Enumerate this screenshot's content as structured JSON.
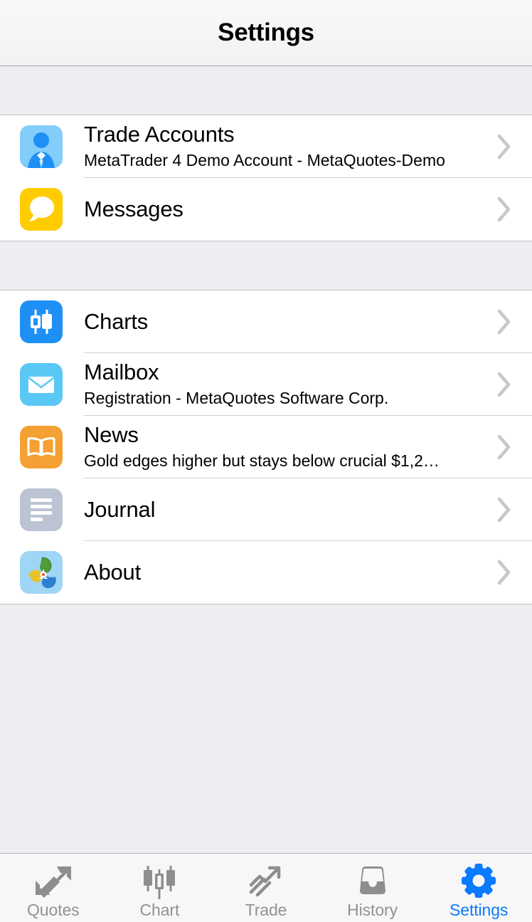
{
  "navbar": {
    "title": "Settings"
  },
  "colors": {
    "accent": "#0a7aff",
    "tab_inactive": "#929292",
    "section_bg": "#eeeef2",
    "row_bg": "#ffffff",
    "separator": "#d2d2d6",
    "chevron": "#c7c7cc",
    "icon_trade_accounts_bg": "#82cdfa",
    "icon_trade_accounts_fg": "#1e90f5",
    "icon_messages_bg": "#ffcc00",
    "icon_charts_bg": "#1e90f5",
    "icon_mailbox_bg": "#5ac8f5",
    "icon_news_bg": "#f5a032",
    "icon_journal_bg": "#bcc3d2",
    "icon_about_bg": "#9fd6f5"
  },
  "sections": [
    {
      "id": "accounts",
      "rows": [
        {
          "id": "trade-accounts",
          "icon": "person-suit-icon",
          "title": "Trade Accounts",
          "subtitle": "MetaTrader 4 Demo Account - MetaQuotes-Demo",
          "accessory": "chevron-right-icon"
        },
        {
          "id": "messages",
          "icon": "speech-bubble-icon",
          "title": "Messages",
          "subtitle": "",
          "accessory": "chevron-right-icon"
        }
      ]
    },
    {
      "id": "tools",
      "rows": [
        {
          "id": "charts",
          "icon": "candlestick-icon",
          "title": "Charts",
          "subtitle": "",
          "accessory": "chevron-right-icon"
        },
        {
          "id": "mailbox",
          "icon": "envelope-icon",
          "title": "Mailbox",
          "subtitle": "Registration - MetaQuotes Software Corp.",
          "accessory": "chevron-right-icon"
        },
        {
          "id": "news",
          "icon": "open-book-icon",
          "title": "News",
          "subtitle": "Gold edges higher but stays below crucial $1,2…",
          "accessory": "chevron-right-icon"
        },
        {
          "id": "journal",
          "icon": "document-lines-icon",
          "title": "Journal",
          "subtitle": "",
          "accessory": "chevron-right-icon"
        },
        {
          "id": "about",
          "icon": "metaquotes-logo-icon",
          "title": "About",
          "subtitle": "",
          "accessory": "chevron-right-icon"
        }
      ]
    }
  ],
  "tabbar": {
    "active": "settings",
    "tabs": [
      {
        "id": "quotes",
        "label": "Quotes",
        "icon": "two-arrows-icon"
      },
      {
        "id": "chart",
        "label": "Chart",
        "icon": "candlestick-icon"
      },
      {
        "id": "trade",
        "label": "Trade",
        "icon": "rising-arrow-icon"
      },
      {
        "id": "history",
        "label": "History",
        "icon": "inbox-tray-icon"
      },
      {
        "id": "settings",
        "label": "Settings",
        "icon": "gear-icon"
      }
    ]
  }
}
